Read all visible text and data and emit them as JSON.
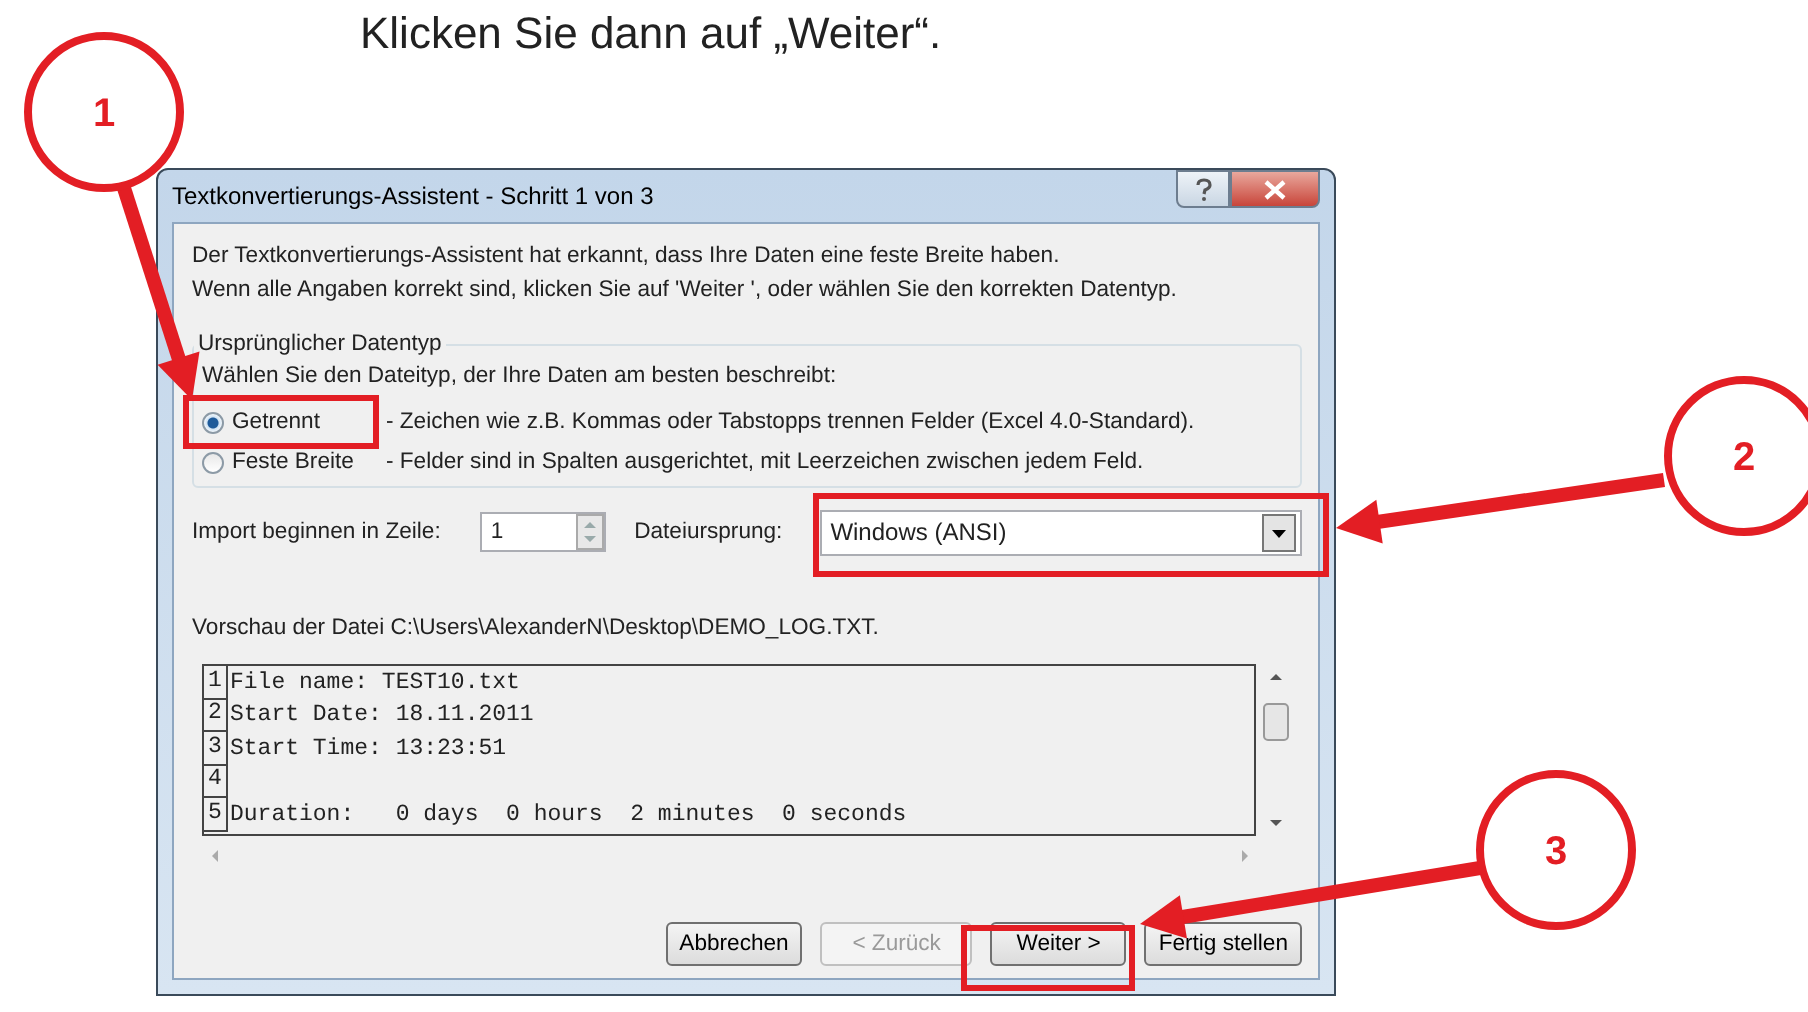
{
  "instruction": "Klicken Sie dann auf „Weiter“.",
  "dialog": {
    "title": "Textkonvertierungs-Assistent - Schritt 1 von 3",
    "intro": [
      "Der Textkonvertierungs-Assistent hat erkannt, dass Ihre Daten eine feste Breite haben.",
      "Wenn alle Angaben korrekt sind, klicken Sie auf 'Weiter ', oder wählen Sie den korrekten Datentyp."
    ],
    "group": {
      "label": "Ursprünglicher Datentyp",
      "prompt": "Wählen Sie den Dateityp, der Ihre Daten am besten beschreibt:",
      "options": [
        {
          "label": "Getrennt",
          "description": "- Zeichen wie z.B. Kommas oder Tabstopps trennen Felder (Excel 4.0-Standard).",
          "selected": true
        },
        {
          "label": "Feste Breite",
          "description": "- Felder sind in Spalten ausgerichtet, mit Leerzeichen zwischen jedem Feld.",
          "selected": false
        }
      ]
    },
    "start_row": {
      "label": "Import beginnen in Zeile:",
      "value": "1"
    },
    "origin": {
      "label": "Dateiursprung:",
      "value": "Windows (ANSI)"
    },
    "preview": {
      "label": "Vorschau der Datei C:\\Users\\AlexanderN\\Desktop\\DEMO_LOG.TXT.",
      "lines": [
        {
          "number": "1",
          "text": "File name: TEST10.txt"
        },
        {
          "number": "2",
          "text": "Start Date: 18.11.2011"
        },
        {
          "number": "3",
          "text": "Start Time: 13:23:51"
        },
        {
          "number": "4"
        },
        {
          "number": "5",
          "text": "Duration:   0 days  0 hours  2 minutes  0 seconds"
        }
      ]
    },
    "buttons": [
      {
        "label": "Abbrechen",
        "disabled": false
      },
      {
        "label": "< Zurück",
        "disabled": true
      },
      {
        "label": "Weiter >",
        "disabled": false
      },
      {
        "label": "Fertig stellen",
        "disabled": false
      }
    ]
  },
  "callouts": [
    {
      "number": "1"
    },
    {
      "number": "2"
    },
    {
      "number": "3"
    }
  ]
}
